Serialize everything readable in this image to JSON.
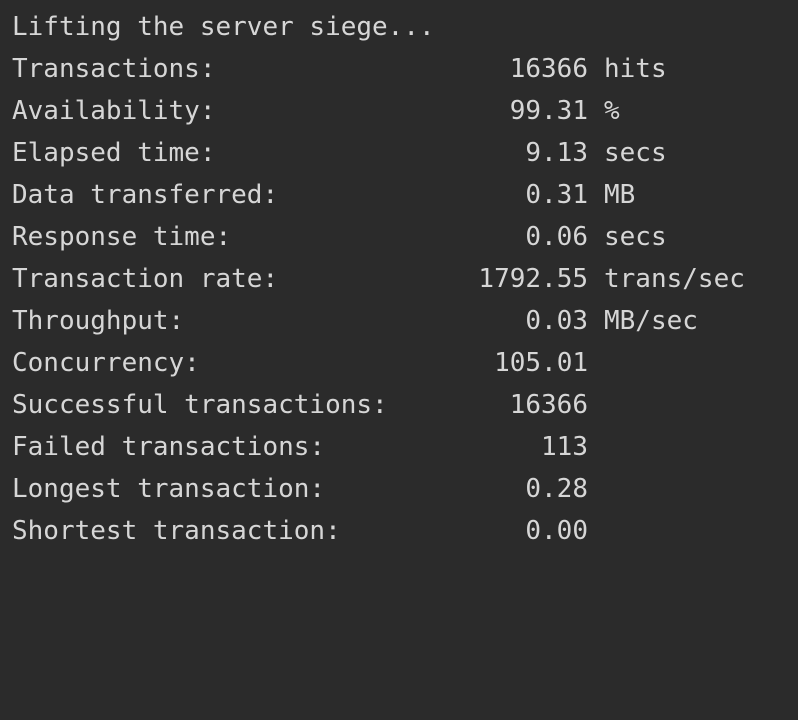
{
  "terminal": {
    "header": "Lifting the server siege...",
    "stats": [
      {
        "label": "Transactions:",
        "value": "16366",
        "unit": "hits"
      },
      {
        "label": "Availability:",
        "value": "99.31",
        "unit": "%"
      },
      {
        "label": "Elapsed time:",
        "value": "9.13",
        "unit": "secs"
      },
      {
        "label": "Data transferred:",
        "value": "0.31",
        "unit": "MB"
      },
      {
        "label": "Response time:",
        "value": "0.06",
        "unit": "secs"
      },
      {
        "label": "Transaction rate:",
        "value": "1792.55",
        "unit": "trans/sec"
      },
      {
        "label": "Throughput:",
        "value": "0.03",
        "unit": "MB/sec"
      },
      {
        "label": "Concurrency:",
        "value": "105.01",
        "unit": ""
      },
      {
        "label": "Successful transactions:",
        "value": "16366",
        "unit": ""
      },
      {
        "label": "Failed transactions:",
        "value": "113",
        "unit": ""
      },
      {
        "label": "Longest transaction:",
        "value": "0.28",
        "unit": ""
      },
      {
        "label": "Shortest transaction:",
        "value": "0.00",
        "unit": ""
      }
    ]
  }
}
